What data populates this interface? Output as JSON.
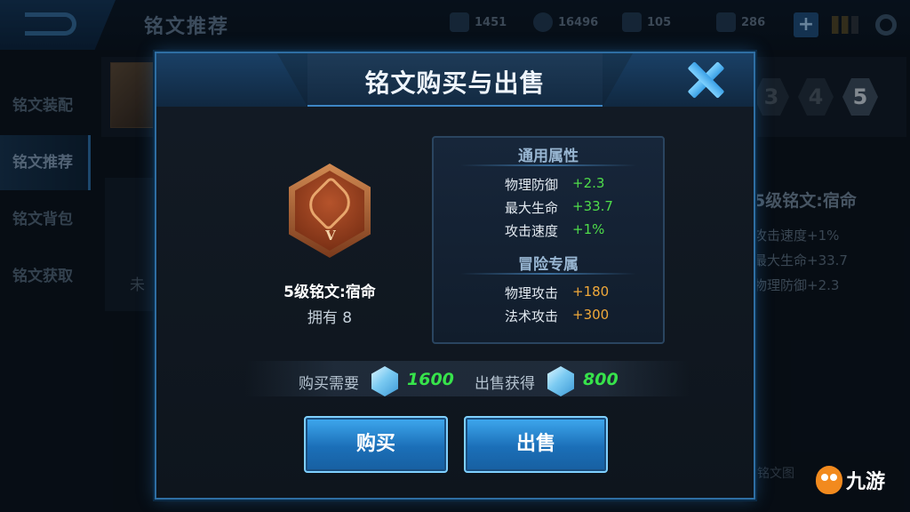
{
  "header": {
    "page_title": "铭文推荐",
    "resources": [
      {
        "icon": "crystal-currency-icon",
        "value": "1451"
      },
      {
        "icon": "coin-currency-icon",
        "value": "16496"
      },
      {
        "icon": "rune-fragment-icon",
        "value": "105"
      },
      {
        "icon": "voucher-icon",
        "value": "286"
      }
    ],
    "plus": "+"
  },
  "sidebar": {
    "items": [
      {
        "label": "铭文装配"
      },
      {
        "label": "铭文推荐"
      },
      {
        "label": "铭文背包"
      },
      {
        "label": "铭文获取"
      }
    ]
  },
  "background": {
    "page_numbers": [
      "3",
      "4",
      "5"
    ],
    "left_text": "未",
    "right_title": "5级铭文:宿命",
    "right_stats": [
      "攻击速度+1%",
      "最大生命+33.7",
      "物理防御+2.3"
    ],
    "bottom_text": "铭文图"
  },
  "modal": {
    "title": "铭文购买与出售",
    "rune": {
      "numeral": "V",
      "name": "5级铭文:宿命",
      "owned": "拥有 8"
    },
    "general_title": "通用属性",
    "general_stats": [
      {
        "label": "物理防御",
        "value": "+2.3"
      },
      {
        "label": "最大生命",
        "value": "+33.7"
      },
      {
        "label": "攻击速度",
        "value": "+1%"
      }
    ],
    "adventure_title": "冒险专属",
    "adventure_stats": [
      {
        "label": "物理攻击",
        "value": "+180"
      },
      {
        "label": "法术攻击",
        "value": "+300"
      }
    ],
    "buy_price_label": "购买需要",
    "buy_price": "1600",
    "sell_price_label": "出售获得",
    "sell_price": "800",
    "buy_button": "购买",
    "sell_button": "出售"
  },
  "watermark": "九游",
  "colors": {
    "stat_green": "#4fdc4a",
    "stat_orange": "#f0a93a",
    "price_green": "#37e34b",
    "button_blue": "#1b6fb8"
  }
}
